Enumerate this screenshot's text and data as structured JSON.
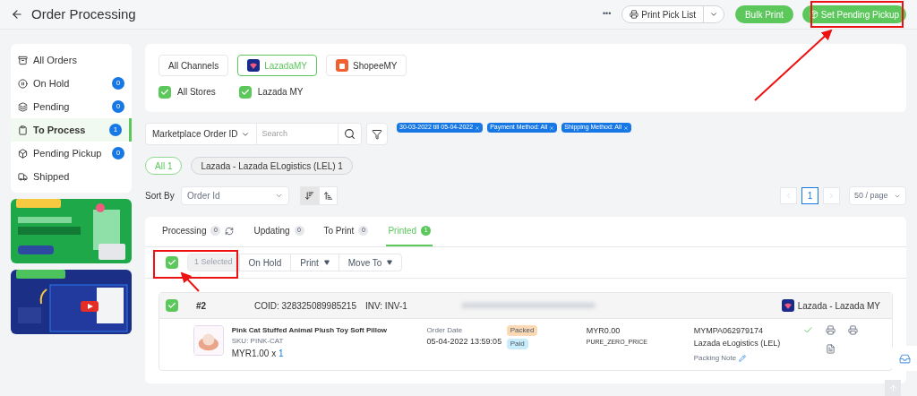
{
  "header": {
    "title": "Order Processing",
    "more": "•••",
    "print_pick_list": "Print Pick List",
    "bulk_print": "Bulk Print",
    "set_pending_pickup": "Set Pending Pickup"
  },
  "sidebar": {
    "items": [
      {
        "label": "All Orders",
        "selected": false
      },
      {
        "label": "On Hold",
        "count": "0",
        "selected": false
      },
      {
        "label": "Pending",
        "count": "0",
        "selected": false
      },
      {
        "label": "To Process",
        "count": "1",
        "selected": true
      },
      {
        "label": "Pending Pickup",
        "count": "0",
        "selected": false
      },
      {
        "label": "Shipped",
        "selected": false
      }
    ]
  },
  "channels": [
    {
      "label": "All Channels",
      "selected": false
    },
    {
      "label": "LazadaMY",
      "selected": true
    },
    {
      "label": "ShopeeMY",
      "selected": false
    }
  ],
  "stores": [
    {
      "label": "All Stores",
      "checked": true
    },
    {
      "label": "Lazada MY",
      "checked": true
    }
  ],
  "search": {
    "field": "Marketplace Order ID",
    "placeholder": "Search"
  },
  "filter_tags": [
    "30-03-2022 till 05-04-2022",
    "Payment Method: All",
    "Shipping Method: All"
  ],
  "shipping_filters": [
    {
      "label": "All 1",
      "selected": true
    },
    {
      "label": "Lazada - Lazada ELogistics (LEL) 1",
      "selected": false
    }
  ],
  "sort": {
    "label": "Sort By",
    "value": "Order Id",
    "descending": true
  },
  "pagination": {
    "page": "1",
    "per_page": "50 / page"
  },
  "status_tabs": [
    {
      "label": "Processing",
      "count": "0",
      "refresh": true,
      "selected": false
    },
    {
      "label": "Updating",
      "count": "0",
      "selected": false
    },
    {
      "label": "To Print",
      "count": "0",
      "selected": false
    },
    {
      "label": "Printed",
      "count": "1",
      "selected": true
    }
  ],
  "bulk_actions": {
    "checked": true,
    "selected_label": "1 Selected",
    "actions": [
      {
        "label": "On Hold",
        "dropdown": false
      },
      {
        "label": "Print",
        "dropdown": true
      },
      {
        "label": "Move To",
        "dropdown": true
      }
    ]
  },
  "order": {
    "checked": true,
    "number": "#2",
    "coid": "COID: 328325089985215",
    "invoice": "INV: INV-1",
    "channel": "Lazada - Lazada MY",
    "item": {
      "name": "Pink Cat Stuffed Animal Plush Toy Soft Pillow",
      "sku": "SKU: PINK-CAT",
      "price": "MYR1.00 x",
      "quantity": "1"
    },
    "date_label": "Order Date",
    "date": "05-04-2022 13:59:05",
    "statuses": [
      {
        "label": "Packed",
        "color": "#fbd9b4"
      },
      {
        "label": "Paid",
        "color": "#c9ecfb"
      }
    ],
    "total": "MYR0.00",
    "price_type": "PURE_ZERO_PRICE",
    "tracking": "MYMPA062979174",
    "shipping": "Lazada eLogistics (LEL)",
    "packing_note": "Packing Note",
    "done": true
  }
}
